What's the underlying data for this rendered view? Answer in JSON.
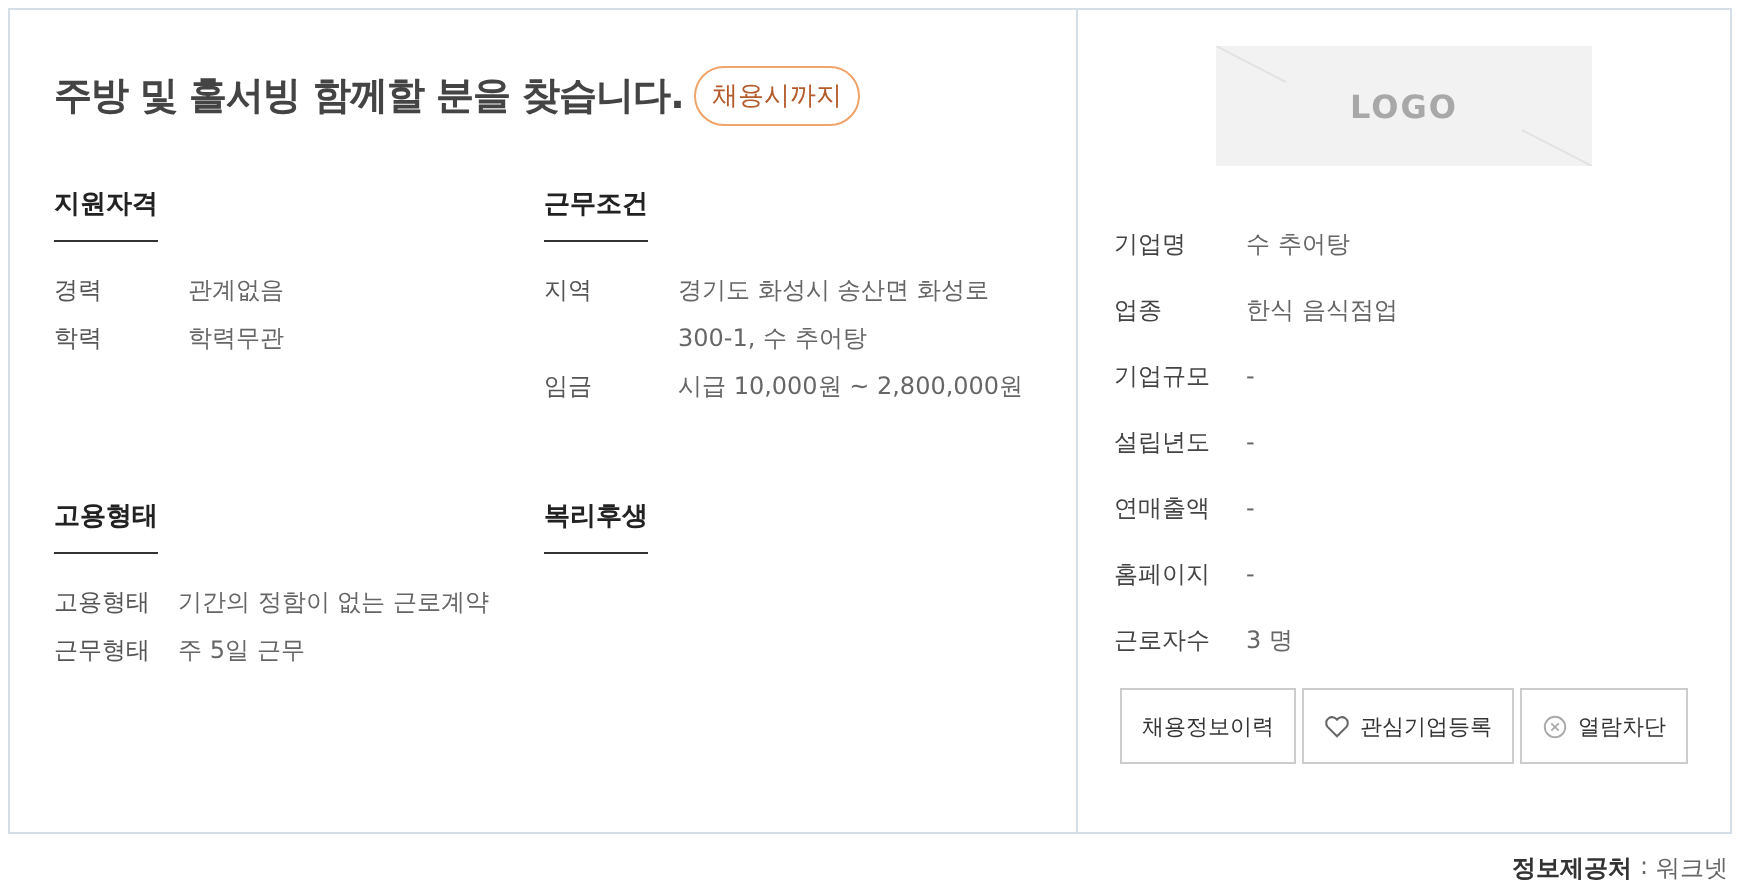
{
  "job": {
    "title": "주방 및 홀서빙 함께할 분을 찾습니다.",
    "deadline_badge": "채용시까지",
    "sections": [
      {
        "heading": "지원자격",
        "items": [
          {
            "label": "경력",
            "value": "관계없음"
          },
          {
            "label": "학력",
            "value": "학력무관"
          }
        ]
      },
      {
        "heading": "근무조건",
        "items": [
          {
            "label": "지역",
            "value": "경기도 화성시 송산면 화성로 300-1, 수 추어탕"
          },
          {
            "label": "임금",
            "value": "시급 10,000원 ~ 2,800,000원"
          }
        ]
      },
      {
        "heading": "고용형태",
        "items": [
          {
            "label": "고용형태",
            "value": "기간의 정함이 없는 근로계약"
          },
          {
            "label": "근무형태",
            "value": "주 5일 근무"
          }
        ]
      },
      {
        "heading": "복리후생"
      }
    ]
  },
  "company": {
    "logo_text": "LOGO",
    "fields": [
      {
        "label": "기업명",
        "value": "수 추어탕"
      },
      {
        "label": "업종",
        "value": "한식 음식점업"
      },
      {
        "label": "기업규모",
        "value": "-"
      },
      {
        "label": "설립년도",
        "value": "-"
      },
      {
        "label": "연매출액",
        "value": "-"
      },
      {
        "label": "홈페이지",
        "value": "-"
      },
      {
        "label": "근로자수",
        "value": "3 명"
      }
    ],
    "buttons": [
      {
        "kind": "plain",
        "label": "채용정보이력"
      },
      {
        "kind": "heart",
        "label": "관심기업등록"
      },
      {
        "kind": "block",
        "label": "열람차단"
      }
    ]
  },
  "source": {
    "label": "정보제공처",
    "separator": ":",
    "value": "워크넷"
  }
}
